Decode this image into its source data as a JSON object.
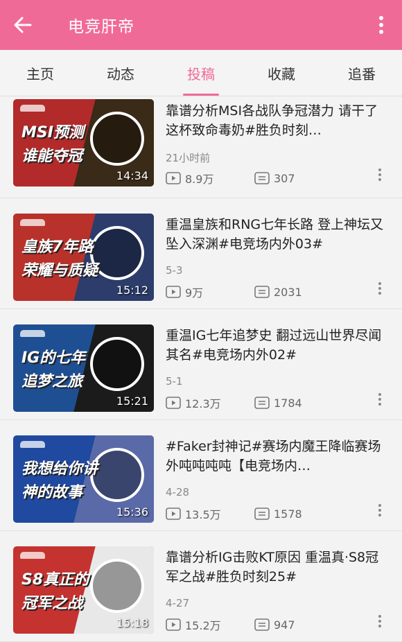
{
  "appbar": {
    "title": "电竞肝帝",
    "back_icon": "arrow-left-icon",
    "more_icon": "more-vertical-icon",
    "color": "#f06a98"
  },
  "tabs": [
    {
      "label": "主页",
      "active": false
    },
    {
      "label": "动态",
      "active": false
    },
    {
      "label": "投稿",
      "active": true
    },
    {
      "label": "收藏",
      "active": false
    },
    {
      "label": "追番",
      "active": false
    }
  ],
  "videos": [
    {
      "title": "靠谱分析MSI各战队争冠潜力 请干了这杯致命毒奶#胜负时刻…",
      "time": "21小时前",
      "plays": "8.9万",
      "comments": "307",
      "duration": "14:34",
      "thumb_text": [
        "MSI预测",
        "谁能夺冠"
      ],
      "thumb_color": "#b22a2a",
      "thumb_accent": "#3a2a18"
    },
    {
      "title": "重温皇族和RNG七年长路 登上神坛又坠入深渊#电竞场内外03#",
      "time": "5-3",
      "plays": "9万",
      "comments": "2031",
      "duration": "15:12",
      "thumb_text": [
        "皇族7年路",
        "荣耀与质疑"
      ],
      "thumb_color": "#b8322b",
      "thumb_accent": "#2c3d6b"
    },
    {
      "title": "重温IG七年追梦史 翻过远山世界尽闻其名#电竞场内外02#",
      "time": "5-1",
      "plays": "12.3万",
      "comments": "1784",
      "duration": "15:21",
      "thumb_text": [
        "IG的七年",
        "追梦之旅"
      ],
      "thumb_color": "#1f4f93",
      "thumb_accent": "#1b1b1b"
    },
    {
      "title": "#Faker封神记#赛场内魔王降临赛场外吨吨吨吨【电竞场内…",
      "time": "4-28",
      "plays": "13.5万",
      "comments": "1578",
      "duration": "15:36",
      "thumb_text": [
        "我想给你讲",
        "神的故事"
      ],
      "thumb_color": "#2049a0",
      "thumb_accent": "#5a6aa8"
    },
    {
      "title": "靠谱分析IG击败KT原因 重温真·S8冠军之战#胜负时刻25#",
      "time": "4-27",
      "plays": "15.2万",
      "comments": "947",
      "duration": "15:18",
      "thumb_text": [
        "S8真正的",
        "冠军之战"
      ],
      "thumb_color": "#c4332f",
      "thumb_accent": "#e8e8e8"
    }
  ]
}
